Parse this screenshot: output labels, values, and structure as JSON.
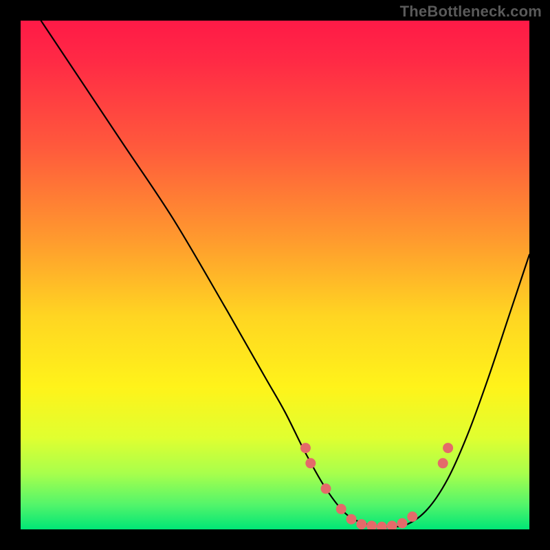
{
  "attribution": "TheBottleneck.com",
  "colors": {
    "background": "#000000",
    "curve_stroke": "#000000",
    "dot_fill": "#e46a6a",
    "dot_stroke": "#c24f4f"
  },
  "chart_data": {
    "type": "line",
    "title": "",
    "xlabel": "",
    "ylabel": "",
    "xlim": [
      0,
      100
    ],
    "ylim": [
      0,
      100
    ],
    "series": [
      {
        "name": "bottleneck-curve",
        "x": [
          4,
          10,
          20,
          30,
          40,
          48,
          52,
          56,
          60,
          64,
          68,
          72,
          76,
          80,
          84,
          88,
          92,
          96,
          100
        ],
        "y": [
          100,
          91,
          76,
          61,
          44,
          30,
          23,
          15,
          8,
          3,
          1,
          0.5,
          1,
          4,
          10,
          19,
          30,
          42,
          54
        ]
      }
    ],
    "scatter": [
      {
        "name": "flat-dots",
        "points": [
          {
            "x": 56.0,
            "y": 16.0
          },
          {
            "x": 57.0,
            "y": 13.0
          },
          {
            "x": 60.0,
            "y": 8.0
          },
          {
            "x": 63.0,
            "y": 4.0
          },
          {
            "x": 65.0,
            "y": 2.0
          },
          {
            "x": 67.0,
            "y": 1.0
          },
          {
            "x": 69.0,
            "y": 0.7
          },
          {
            "x": 71.0,
            "y": 0.5
          },
          {
            "x": 73.0,
            "y": 0.7
          },
          {
            "x": 75.0,
            "y": 1.2
          },
          {
            "x": 77.0,
            "y": 2.5
          },
          {
            "x": 83.0,
            "y": 13.0
          },
          {
            "x": 84.0,
            "y": 16.0
          }
        ]
      }
    ]
  }
}
